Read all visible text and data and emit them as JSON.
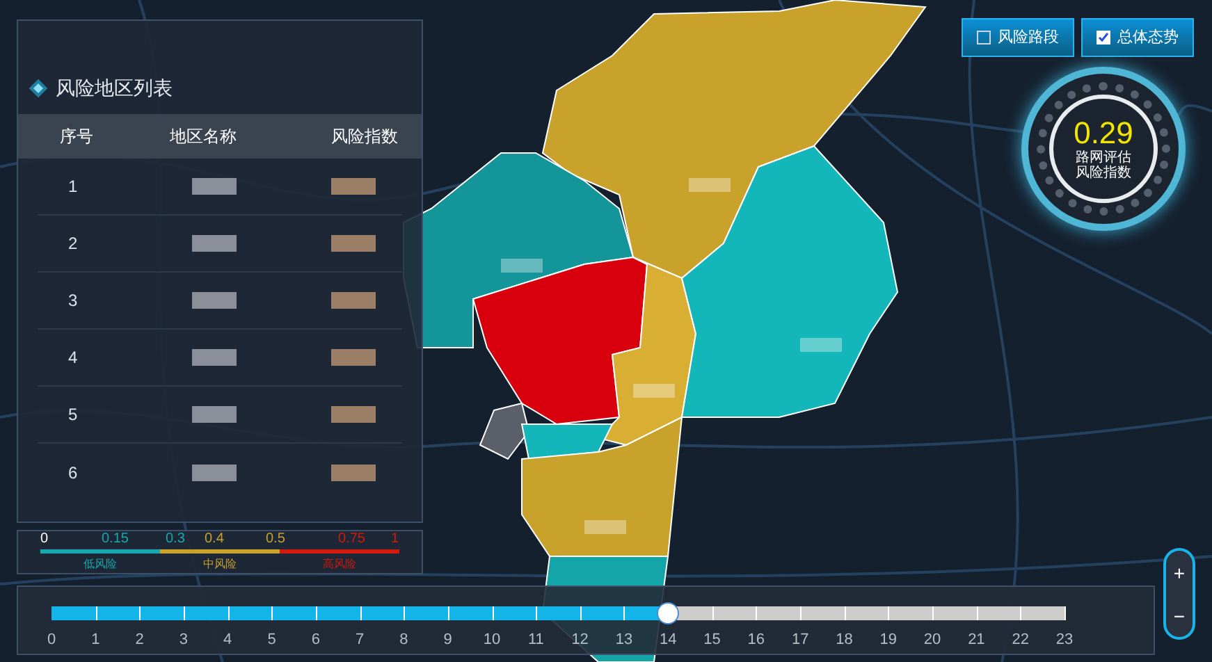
{
  "risk_list": {
    "title": "风险地区列表",
    "columns": [
      "序号",
      "地区名称",
      "风险指数"
    ],
    "rows": [
      {
        "number": "1"
      },
      {
        "number": "2"
      },
      {
        "number": "3"
      },
      {
        "number": "4"
      },
      {
        "number": "5"
      },
      {
        "number": "6"
      }
    ]
  },
  "legend": {
    "ticks": [
      {
        "label": "0",
        "color": "#ffffff"
      },
      {
        "label": "0.15",
        "color": "#16a9ad"
      },
      {
        "label": "0.3",
        "color": "#16a9ad"
      },
      {
        "label": "0.4",
        "color": "#c9a22c"
      },
      {
        "label": "0.5",
        "color": "#c9a22c"
      },
      {
        "label": "0.75",
        "color": "#d11a0e"
      },
      {
        "label": "1",
        "color": "#d11a0e"
      }
    ],
    "levels": [
      {
        "label": "低风险",
        "color": "#16a9ad"
      },
      {
        "label": "中风险",
        "color": "#c9a22c"
      },
      {
        "label": "高风险",
        "color": "#d11a0e"
      }
    ]
  },
  "toggles": [
    {
      "label": "风险路段",
      "checked": false
    },
    {
      "label": "总体态势",
      "checked": true
    }
  ],
  "gauge": {
    "value": "0.29",
    "caption_1": "路网评估",
    "caption_2": "风险指数"
  },
  "zoom": {
    "in": "+",
    "out": "−"
  },
  "timeline": {
    "level": 0.6087,
    "ticks": [
      "0",
      "1",
      "2",
      "3",
      "4",
      "5",
      "6",
      "7",
      "8",
      "9",
      "10",
      "11",
      "12",
      "13",
      "14",
      "15",
      "16",
      "17",
      "18",
      "19",
      "20",
      "21",
      "22",
      "23"
    ]
  }
}
